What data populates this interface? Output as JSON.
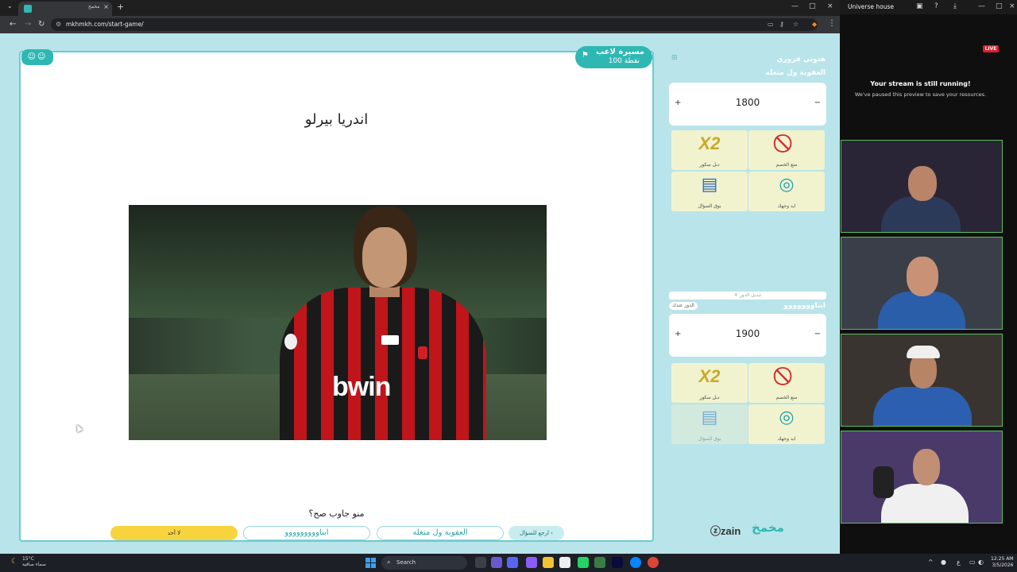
{
  "browser": {
    "tab_title": "مخمخ",
    "tab_close": "×",
    "new_tab": "+",
    "url": "mkhmkh.com/start-game/",
    "window_controls": [
      "—",
      "□",
      "×"
    ]
  },
  "game": {
    "answer_title": "اندريا بيرلو",
    "smileys": "☺☺",
    "player_name": "مسيرة لاعب",
    "player_points": "100 نقطة",
    "flag": "⚑",
    "photo_sponsor_text": "bwin",
    "question": "منو جاوب صح؟",
    "buttons": {
      "nobody": "لا أحد",
      "team_b": "ابناووووووووو",
      "team_a": "العفوية ول متغله",
      "back": "ارجع للسؤال ‹"
    }
  },
  "sidebar": {
    "corner_label": "⊞",
    "team_a": {
      "label": "هتوني فزوري",
      "name": "العفوية ول متغله",
      "score": "1800",
      "plus": "+",
      "minus": "−",
      "aids": [
        {
          "icon": "X2",
          "label": "دبل سكور",
          "used": false
        },
        {
          "icon": "⃠",
          "label": "منع الخصم",
          "used": false
        },
        {
          "icon": "▤",
          "label": "بوق السؤال",
          "used": false
        },
        {
          "icon": "◎",
          "label": "ابد وجهك",
          "used": false
        }
      ]
    },
    "switch_turn": "✕ تبديل الدور",
    "turn_label": "الدور عندك",
    "team_b": {
      "name": "ابناووووووو",
      "score": "1900",
      "plus": "+",
      "minus": "−",
      "aids": [
        {
          "icon": "X2",
          "label": "دبل سكور",
          "used": false
        },
        {
          "icon": "⃠",
          "label": "منع الخصم",
          "used": false
        },
        {
          "icon": "▤",
          "label": "بوق السؤال",
          "used": true
        },
        {
          "icon": "◎",
          "label": "ابد وجهك",
          "used": false
        }
      ]
    },
    "sponsor": "ⓩzain",
    "brand": "مخمخ"
  },
  "stream": {
    "title": "Universe house",
    "live": "LIVE",
    "message_title": "Your stream is still running!",
    "message_body": "We've paused this preview to save your resources."
  },
  "taskbar": {
    "temperature": "15°C",
    "weather": "سماء صافية",
    "search": "Search",
    "time": "12:25 AM",
    "date": "3/5/2026",
    "lang": "ع"
  }
}
